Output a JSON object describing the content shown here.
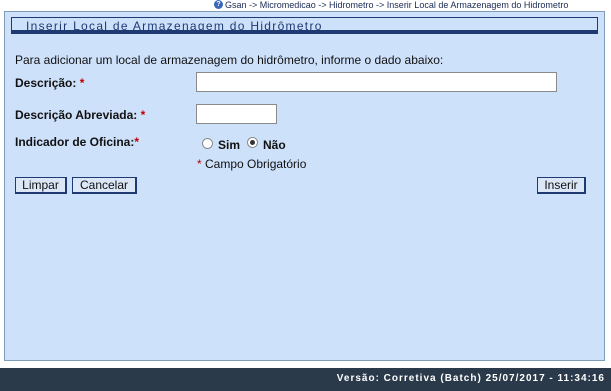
{
  "breadcrumb": {
    "icon": "help-icon",
    "text": "Gsan -> Micromedicao -> Hidrometro -> Inserir Local de Armazenagem do Hidrometro"
  },
  "panel": {
    "title": "Inserir Local de Armazenagem do Hidrômetro",
    "instructions": "Para adicionar um local de armazenagem do hidrômetro, informe o dado abaixo:"
  },
  "form": {
    "descricao": {
      "label": "Descrição:",
      "required_mark": "*",
      "value": ""
    },
    "descricao_abreviada": {
      "label": "Descrição Abreviada:",
      "required_mark": "*",
      "value": ""
    },
    "indicador_oficina": {
      "label": "Indicador de Oficina:",
      "required_mark": "*",
      "options": [
        {
          "label": "Sim",
          "checked": false
        },
        {
          "label": "Não",
          "checked": true
        }
      ]
    },
    "legend": {
      "mark": "*",
      "text": "Campo Obrigatório"
    }
  },
  "buttons": {
    "limpar": "Limpar",
    "cancelar": "Cancelar",
    "inserir": "Inserir"
  },
  "footer": {
    "version": "Versão: Corretiva (Batch) 25/07/2017 - 11:34:16"
  },
  "colors": {
    "panel_bg": "#cee1fb",
    "title_border": "#1f3a73",
    "required": "#c00000",
    "footer_bg": "#2b3a4a"
  }
}
